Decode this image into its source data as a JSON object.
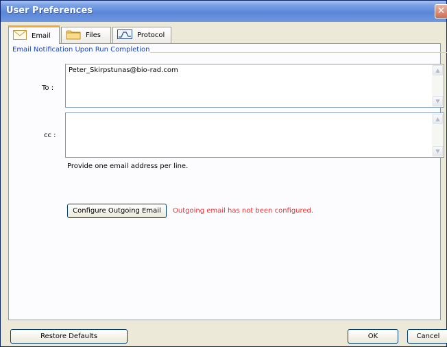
{
  "window": {
    "title": "User Preferences",
    "close_glyph": "✕"
  },
  "tabs": [
    {
      "label": "Email",
      "icon": "envelope-icon",
      "active": true
    },
    {
      "label": "Files",
      "icon": "folder-icon",
      "active": false
    },
    {
      "label": "Protocol",
      "icon": "protocol-chart-icon",
      "active": false
    }
  ],
  "email": {
    "group_title": "Email Notification Upon Run Completion",
    "to_label": "To :",
    "to_value": "Peter_Skirpstunas@bio-rad.com",
    "cc_label": "cc :",
    "cc_value": "",
    "hint": "Provide one email address per line.",
    "configure_button": "Configure Outgoing Email",
    "status_message": "Outgoing email has not been configured.",
    "status_color": "#ff2a2a"
  },
  "footer": {
    "restore_defaults": "Restore Defaults",
    "ok": "OK",
    "cancel": "Cancel"
  },
  "colors": {
    "titlebar": "#5a86d8",
    "active_tab_accent": "#f3a935",
    "group_title": "#1c46c8"
  }
}
